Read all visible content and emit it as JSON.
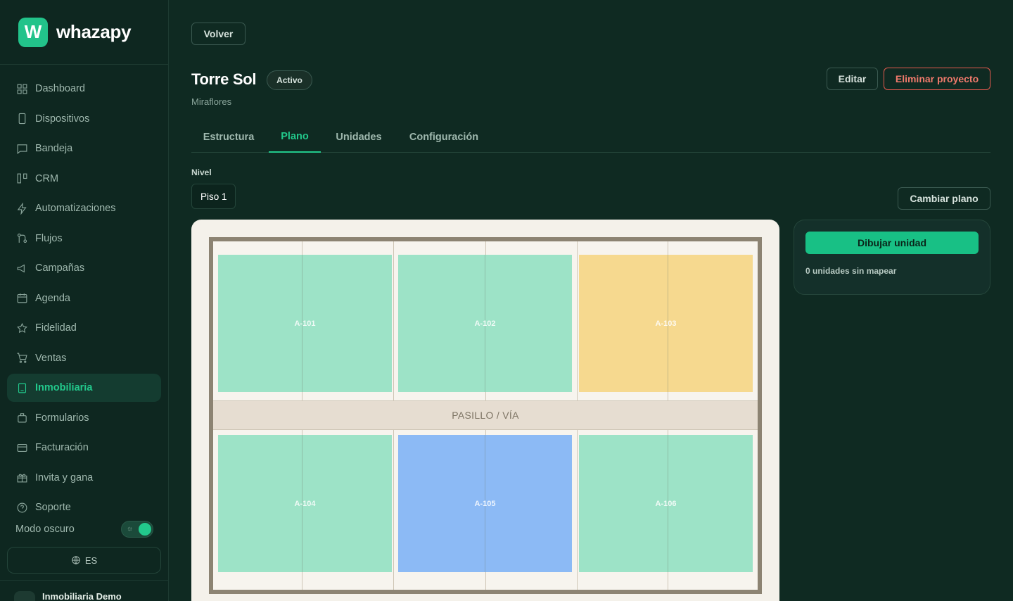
{
  "brand": {
    "logo_letter": "W",
    "name": "whazapy"
  },
  "sidebar": {
    "items": [
      {
        "label": "Dashboard",
        "icon": "grid-icon"
      },
      {
        "label": "Dispositivos",
        "icon": "smartphone-icon"
      },
      {
        "label": "Bandeja",
        "icon": "message-icon"
      },
      {
        "label": "CRM",
        "icon": "kanban-icon"
      },
      {
        "label": "Automatizaciones",
        "icon": "zap-icon"
      },
      {
        "label": "Flujos",
        "icon": "git-branch-icon"
      },
      {
        "label": "Campañas",
        "icon": "megaphone-icon"
      },
      {
        "label": "Agenda",
        "icon": "calendar-icon"
      },
      {
        "label": "Fidelidad",
        "icon": "star-icon"
      },
      {
        "label": "Ventas",
        "icon": "cart-icon"
      },
      {
        "label": "Inmobiliaria",
        "icon": "building-icon",
        "active": true
      },
      {
        "label": "Formularios",
        "icon": "clipboard-icon"
      },
      {
        "label": "Facturación",
        "icon": "credit-card-icon"
      },
      {
        "label": "Invita y gana",
        "icon": "gift-icon"
      },
      {
        "label": "Soporte",
        "icon": "help-icon"
      }
    ],
    "dark_mode_label": "Modo oscuro",
    "dark_mode_on": true,
    "language": "ES",
    "account_name": "Inmobiliaria Demo"
  },
  "header": {
    "back_label": "Volver",
    "title": "Torre Sol",
    "status_badge": "Activo",
    "subtitle": "Miraflores",
    "edit_label": "Editar",
    "delete_label": "Eliminar proyecto"
  },
  "tabs": [
    {
      "label": "Estructura",
      "active": false
    },
    {
      "label": "Plano",
      "active": true
    },
    {
      "label": "Unidades",
      "active": false
    },
    {
      "label": "Configuración",
      "active": false
    }
  ],
  "level": {
    "label": "Nivel",
    "value": "Piso 1"
  },
  "change_plan_label": "Cambiar plano",
  "plan": {
    "corridor_label": "PASILLO / VÍA",
    "units": [
      {
        "code": "A-101",
        "color": "#9de3c7"
      },
      {
        "code": "A-102",
        "color": "#9de3c7"
      },
      {
        "code": "A-103",
        "color": "#f6d98f"
      },
      {
        "code": "A-104",
        "color": "#9de3c7"
      },
      {
        "code": "A-105",
        "color": "#8cbaf5"
      },
      {
        "code": "A-106",
        "color": "#9de3c7"
      }
    ]
  },
  "side_panel": {
    "draw_label": "Dibujar unidad",
    "unmapped_text": "0 unidades sin mapear"
  },
  "colors": {
    "accent": "#22c98c",
    "background": "#0f2a22",
    "danger": "#e25a4e"
  }
}
